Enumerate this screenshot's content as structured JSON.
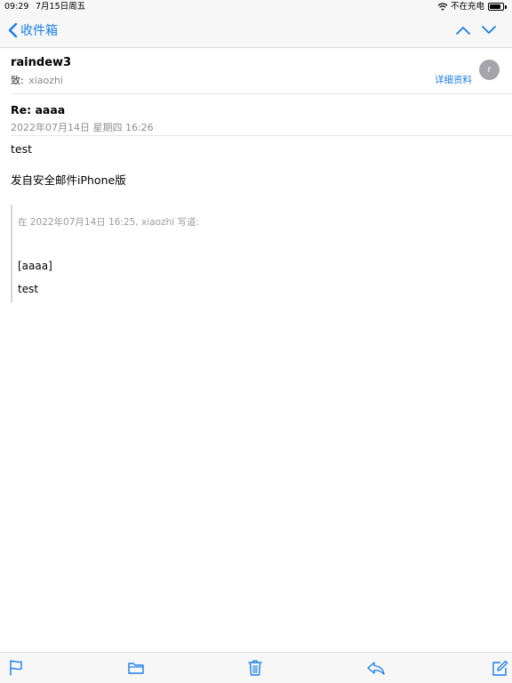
{
  "status_bar": {
    "time": "09:29",
    "date": "7月15日周五",
    "charging_text": "不在充电",
    "battery_level": 0.85
  },
  "nav": {
    "back_label": "收件箱",
    "icons": [
      "chevron-left-icon",
      "chevron-up-icon",
      "chevron-down-icon"
    ]
  },
  "sender": {
    "name": "raindew3",
    "to_label": "致:",
    "to_value": "xiaozhi",
    "details_link": "详细资料",
    "avatar_letter": "r"
  },
  "message": {
    "subject": "Re: aaaa",
    "date": "2022年07月14日 星期四 16:26",
    "body_lines": [
      "test",
      "发自安全邮件iPhone版"
    ],
    "quote_header": "在 2022年07月14日 16:25, xiaozhi 写道:",
    "quote_lines": [
      "[aaaa]",
      "test"
    ]
  },
  "toolbar": {
    "icons": [
      "flag-icon",
      "folder-icon",
      "trash-icon",
      "reply-icon",
      "compose-icon"
    ]
  },
  "colors": {
    "accent": "#1a7ee6",
    "bar_background": "#f7f7f7",
    "secondary_text": "#8e8e93"
  }
}
